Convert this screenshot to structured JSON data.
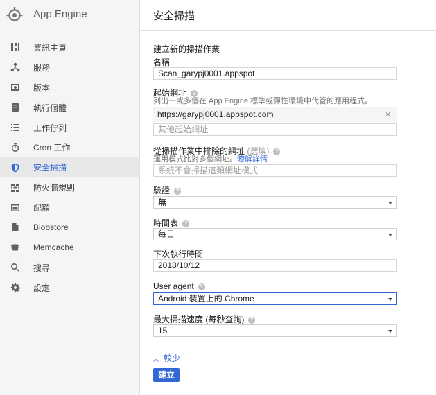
{
  "app": {
    "name": "App Engine"
  },
  "sidebar": {
    "items": [
      {
        "label": "資訊主頁",
        "icon": "dashboard-icon"
      },
      {
        "label": "服務",
        "icon": "services-icon"
      },
      {
        "label": "版本",
        "icon": "versions-icon"
      },
      {
        "label": "執行個體",
        "icon": "instances-icon"
      },
      {
        "label": "工作佇列",
        "icon": "task-queues-icon"
      },
      {
        "label": "Cron 工作",
        "icon": "timer-icon"
      },
      {
        "label": "安全掃描",
        "icon": "shield-icon",
        "active": true
      },
      {
        "label": "防火牆規則",
        "icon": "firewall-icon"
      },
      {
        "label": "配額",
        "icon": "quotas-icon"
      },
      {
        "label": "Blobstore",
        "icon": "file-icon"
      },
      {
        "label": "Memcache",
        "icon": "memcache-icon"
      },
      {
        "label": "搜尋",
        "icon": "search-icon"
      },
      {
        "label": "設定",
        "icon": "gear-icon"
      }
    ]
  },
  "page": {
    "title": "安全掃描"
  },
  "form": {
    "heading": "建立新的掃描作業",
    "name": {
      "label": "名稱",
      "value": "Scan_garypj0001.appspot"
    },
    "start_urls": {
      "label": "起始網址",
      "hint": "列出一或多個在 App Engine 標準或彈性環境中代管的應用程式。",
      "chip": "https://garypj0001.appspot.com",
      "chip_remove": "×",
      "placeholder": "其他起始網址"
    },
    "excluded": {
      "label": "從掃描作業中排除的網址",
      "optional": "(選填)",
      "hint": "運用模式比對多個網址。",
      "link": "瞭解詳情",
      "placeholder": "系統不會掃描這類網址模式"
    },
    "auth": {
      "label": "驗證",
      "value": "無"
    },
    "schedule": {
      "label": "時間表",
      "value": "每日"
    },
    "next_run": {
      "label": "下次執行時間",
      "value": "2018/10/12"
    },
    "user_agent": {
      "label": "User agent",
      "value": "Android 裝置上的 Chrome"
    },
    "max_rate": {
      "label": "最大掃描速度 (每秒查詢)",
      "value": "15"
    },
    "less_link": "較少",
    "submit": "建立"
  },
  "colors": {
    "accent": "#3367d6",
    "sidebar_bg": "#f5f5f5"
  }
}
